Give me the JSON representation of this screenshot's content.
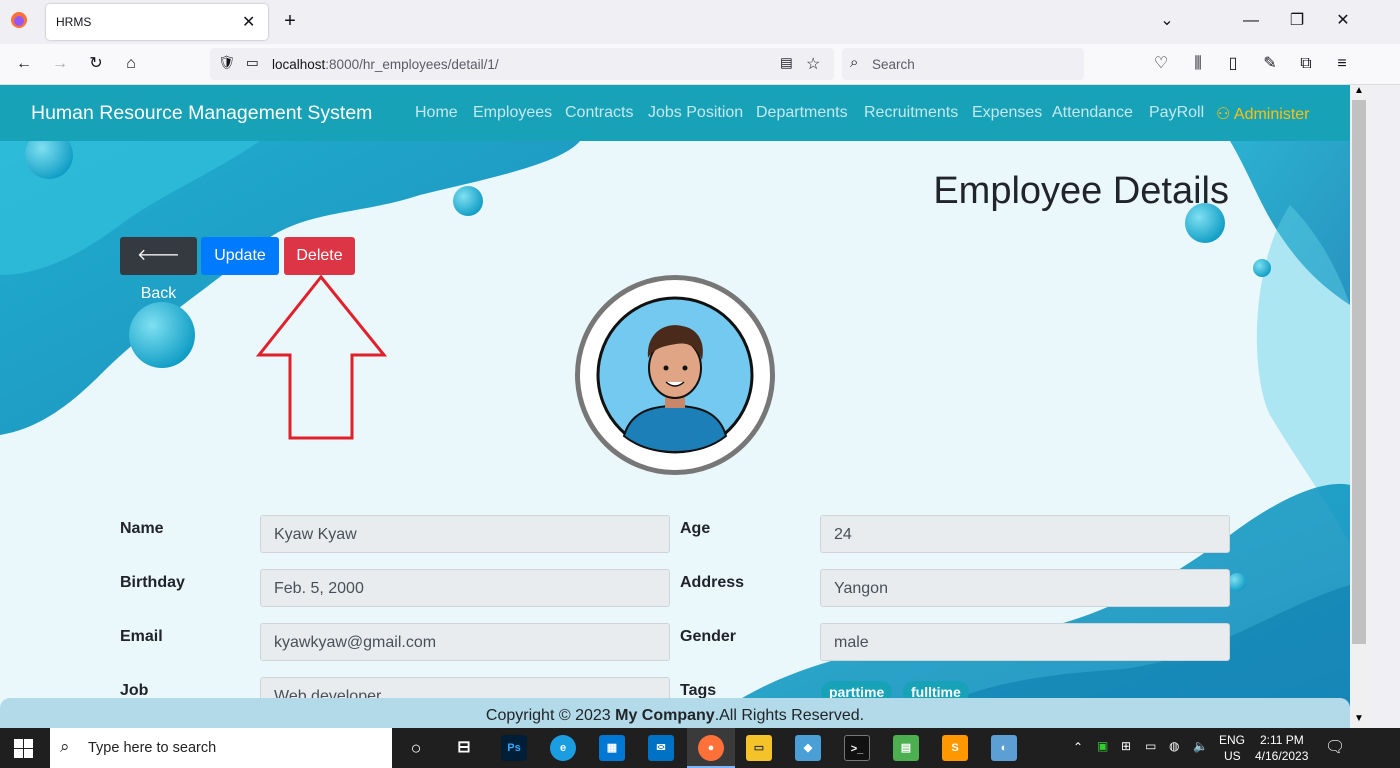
{
  "browser": {
    "tab_title": "HRMS",
    "url_host": "localhost",
    "url_rest": ":8000/hr_employees/detail/1/",
    "search_placeholder": "Search"
  },
  "app": {
    "brand": "Human Resource Management System",
    "nav": [
      "Home",
      "Employees",
      "Contracts",
      "Jobs Position",
      "Departments",
      "Recruitments",
      "Expenses",
      "Attendance",
      "PayRoll"
    ],
    "admin": "Administer",
    "page_title": "Employee Details",
    "buttons": {
      "back": "Back",
      "update": "Update",
      "delete": "Delete"
    },
    "fields": {
      "name_label": "Name",
      "name": "Kyaw Kyaw",
      "age_label": "Age",
      "age": "24",
      "birthday_label": "Birthday",
      "birthday": "Feb. 5, 2000",
      "address_label": "Address",
      "address": "Yangon",
      "email_label": "Email",
      "email": "kyawkyaw@gmail.com",
      "gender_label": "Gender",
      "gender": "male",
      "job_label": "Job",
      "job": "Web developer",
      "tags_label": "Tags",
      "tags": [
        "parttime",
        "fulltime"
      ]
    },
    "footer": {
      "prefix": "Copyright © 2023 ",
      "company": "My Company",
      "suffix": ".All Rights Reserved."
    },
    "colors": {
      "primary": "#17a2b8",
      "dark": "#343a40",
      "blue": "#007bff",
      "red": "#dc3545",
      "warning": "#ffc107"
    }
  },
  "taskbar": {
    "search_placeholder": "Type here to search",
    "lang": "ENG",
    "region": "US",
    "time": "2:11 PM",
    "date": "4/16/2023"
  }
}
